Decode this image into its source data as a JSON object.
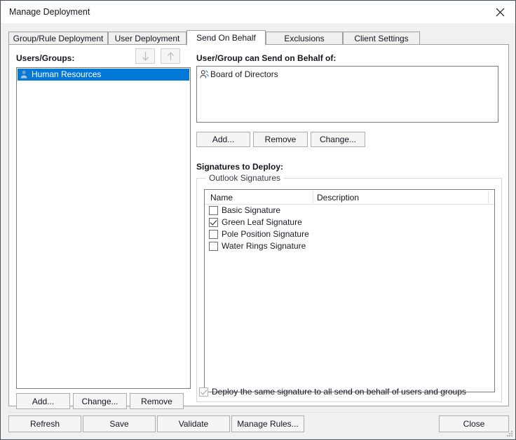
{
  "window": {
    "title": "Manage Deployment",
    "close_icon": "close-icon"
  },
  "tabs": [
    {
      "label": "Group/Rule Deployment",
      "active": false
    },
    {
      "label": "User Deployment",
      "active": false
    },
    {
      "label": "Send On Behalf",
      "active": true
    },
    {
      "label": "Exclusions",
      "active": false
    },
    {
      "label": "Client Settings",
      "active": false
    }
  ],
  "left_panel": {
    "label": "Users/Groups:",
    "move_down_icon": "arrow-down-icon",
    "move_up_icon": "arrow-up-icon",
    "items": [
      {
        "name": "Human Resources",
        "icon": "group-icon",
        "selected": true
      }
    ],
    "buttons": {
      "add": "Add...",
      "change": "Change...",
      "remove": "Remove"
    }
  },
  "send_on_behalf": {
    "label": "User/Group can Send on Behalf of:",
    "items": [
      {
        "name": "Board of Directors",
        "icon": "group-icon"
      }
    ],
    "buttons": {
      "add": "Add...",
      "remove": "Remove",
      "change": "Change..."
    }
  },
  "signatures": {
    "label": "Signatures to Deploy:",
    "group_title": "Outlook Signatures",
    "columns": [
      "Name",
      "Description"
    ],
    "rows": [
      {
        "name": "Basic Signature",
        "description": "",
        "checked": false
      },
      {
        "name": "Green Leaf Signature",
        "description": "",
        "checked": true
      },
      {
        "name": "Pole Position Signature",
        "description": "",
        "checked": false
      },
      {
        "name": "Water Rings Signature",
        "description": "",
        "checked": false
      }
    ],
    "deploy_same": {
      "label": "Deploy the same signature to all send on behalf of users and groups",
      "checked": true,
      "disabled": true
    }
  },
  "bottom_buttons": {
    "refresh": "Refresh",
    "save": "Save",
    "validate": "Validate",
    "manage_rules": "Manage Rules...",
    "close": "Close"
  },
  "colors": {
    "selection_blue": "#0078d7",
    "window_border": "#4b4f5e",
    "panel_background": "#f0f0f0"
  }
}
